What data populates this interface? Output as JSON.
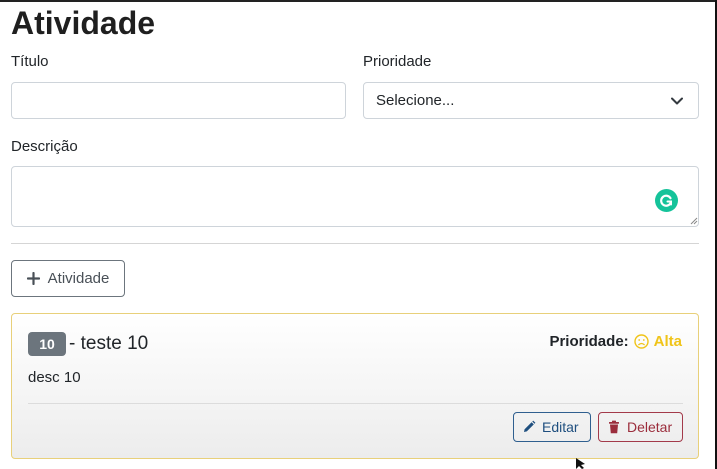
{
  "form": {
    "title": "Atividade",
    "titulo_label": "Título",
    "titulo_value": "",
    "prioridade_label": "Prioridade",
    "prioridade_selected": "Selecione...",
    "descricao_label": "Descrição",
    "descricao_value": "",
    "add_button_label": "Atividade"
  },
  "activity": {
    "id": "10",
    "title": "- teste 10",
    "priority_label": "Prioridade:",
    "priority_value": "Alta",
    "priority_icon": "frown-icon",
    "description": "desc 10",
    "edit_label": "Editar",
    "delete_label": "Deletar"
  },
  "colors": {
    "priority_alta": "#f0c419",
    "card_border": "#e8d07a",
    "grammarly": "#15c39a",
    "badge": "#6c757d"
  }
}
